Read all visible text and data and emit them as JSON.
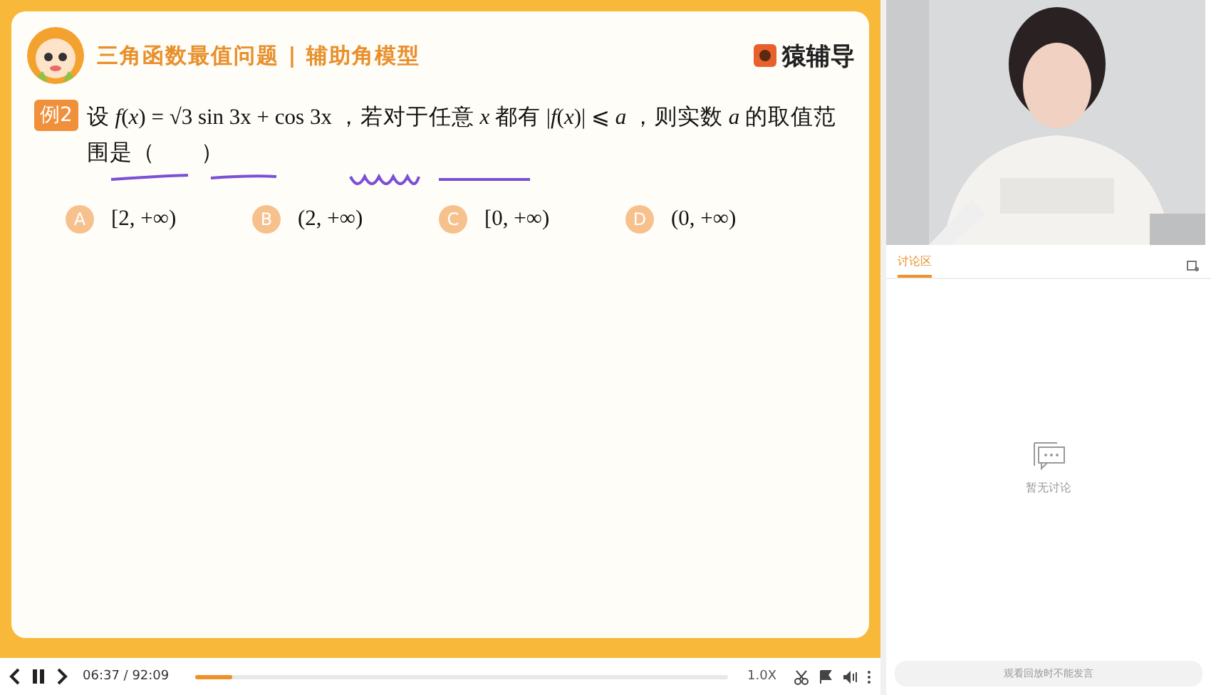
{
  "slide": {
    "title": "三角函数最值问题 | 辅助角模型",
    "brand": "猿辅导",
    "question": {
      "badge": "例2",
      "text": "设 *f*(*x*) = √3 sin 3x + cos 3x ，若对于任意 *x* 都有 |*f*(*x*)| ⩽ *a* ，则实数 *a* 的取值范围是（　　）",
      "options": [
        {
          "letter": "A",
          "text": "[2, +∞)"
        },
        {
          "letter": "B",
          "text": "(2, +∞)"
        },
        {
          "letter": "C",
          "text": "[0, +∞)"
        },
        {
          "letter": "D",
          "text": "(0, +∞)"
        }
      ]
    }
  },
  "player": {
    "time": "06:37 / 92:09",
    "level": 0.07,
    "speed": "1.0X",
    "playing": true
  },
  "side": {
    "tabs": [
      {
        "label": "讨论区",
        "selected": true
      }
    ],
    "empty_text": "暂无讨论",
    "input": {
      "placeholder": "观看回放时不能发言"
    }
  }
}
